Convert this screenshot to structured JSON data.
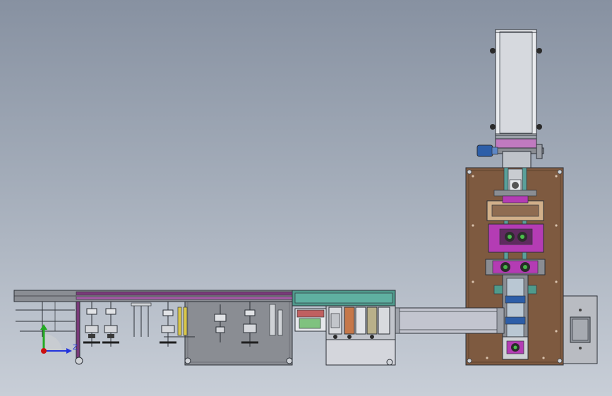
{
  "view": {
    "background_top": "#8791a1",
    "background_bottom": "#c8ced7"
  },
  "colors": {
    "frame_brown": "#7e5a40",
    "steel_gray": "#8a8d93",
    "magenta": "#b43cb4",
    "purple_rail": "#7a3a7a",
    "teal_cover": "#4f9a8c",
    "conveyor_light": "#c3c5cf",
    "motor_blue": "#2d5ea8",
    "cabinet_gray": "#b9bcc2"
  },
  "triad": {
    "z_label": "Z",
    "x_color": "#2233dd",
    "y_color": "#22aa22",
    "origin_color": "#cc1111"
  }
}
